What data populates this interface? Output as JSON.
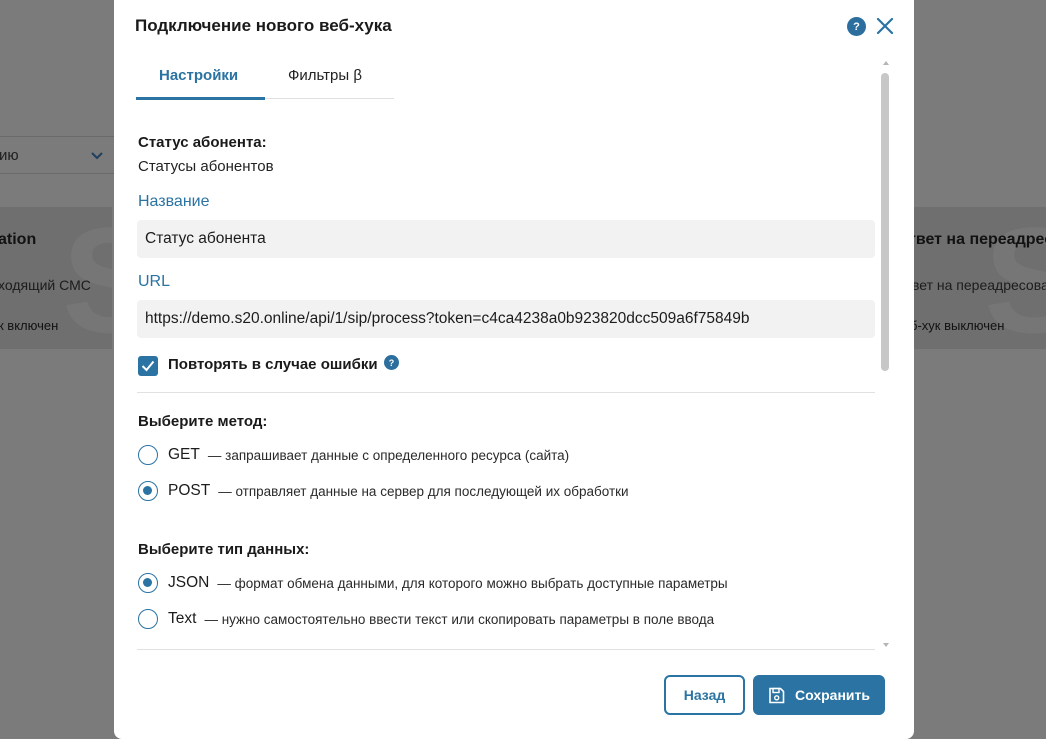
{
  "background": {
    "select_text": "ию",
    "left_card": {
      "title": "ation",
      "subtitle": "ходящий СМС",
      "status": "к включен"
    },
    "right_card": {
      "title": "твет на переадрес",
      "subtitle": "вет на переадресова",
      "status": "б-хук выключен"
    }
  },
  "modal": {
    "title": "Подключение нового веб-хука",
    "help_icon": "?",
    "tabs": [
      {
        "label": "Настройки",
        "active": true
      },
      {
        "label": "Фильтры β",
        "active": false
      }
    ],
    "status_label": "Статус абонента:",
    "status_value": "Статусы абонентов",
    "name_label": "Название",
    "name_value": "Статус абонента",
    "url_label": "URL",
    "url_value": "https://demo.s20.online/api/1/sip/process?token=c4ca4238a0b923820dcc509a6f75849b",
    "retry_label": "Повторять в случае ошибки",
    "retry_checked": true,
    "method_heading": "Выберите метод:",
    "methods": [
      {
        "name": "GET",
        "desc": "— запрашивает данные с определенного ресурса (сайта)",
        "selected": false
      },
      {
        "name": "POST",
        "desc": "— отправляет данные на сервер для последующей их обработки",
        "selected": true
      }
    ],
    "datatype_heading": "Выберите тип данных:",
    "datatypes": [
      {
        "name": "JSON",
        "desc": "— формат обмена данными, для которого можно выбрать доступные параметры",
        "selected": true
      },
      {
        "name": "Text",
        "desc": "— нужно самостоятельно ввести текст или скопировать параметры в поле ввода",
        "selected": false
      }
    ],
    "back_label": "Назад",
    "save_label": "Сохранить"
  },
  "colors": {
    "accent": "#2a73a2",
    "overlay": "#7b7b7b"
  }
}
